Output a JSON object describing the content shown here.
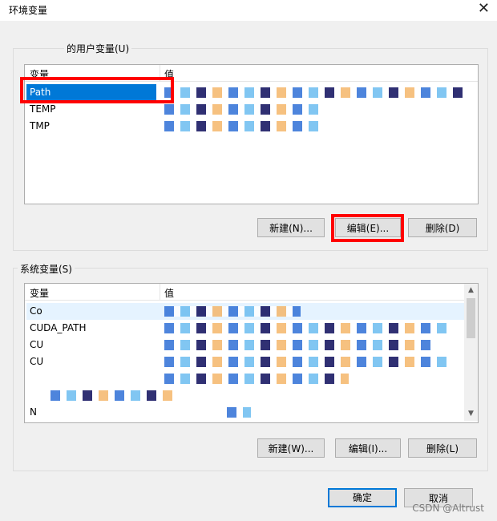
{
  "window": {
    "title": "环境变量",
    "close_glyph": "✕"
  },
  "user_section": {
    "group_label": "的用户变量(U)",
    "columns": {
      "name": "变量",
      "value": "值"
    },
    "rows": [
      {
        "name": "Path",
        "selected": true
      },
      {
        "name": "TEMP",
        "selected": false
      },
      {
        "name": "TMP",
        "selected": false
      }
    ],
    "buttons": {
      "new": "新建(N)...",
      "edit": "编辑(E)...",
      "delete": "删除(D)"
    }
  },
  "system_section": {
    "group_label": "系统变量(S)",
    "columns": {
      "name": "变量",
      "value": "值"
    },
    "rows": [
      {
        "name": "Co",
        "hover": true
      },
      {
        "name": "CUDA_PATH",
        "hover": false
      },
      {
        "name": "CU",
        "hover": false
      },
      {
        "name": "CU",
        "hover": false
      },
      {
        "name": "",
        "hover": false
      },
      {
        "name": "",
        "hover": false
      },
      {
        "name": "N",
        "hover": false
      }
    ],
    "buttons": {
      "new": "新建(W)...",
      "edit": "编辑(I)...",
      "delete": "删除(L)"
    }
  },
  "dialog_buttons": {
    "ok": "确定",
    "cancel": "取消"
  },
  "watermark": "CSDN @Altrust",
  "colors": {
    "selection": "#0078d7",
    "highlight_box": "#ff0000",
    "hover_row": "#e5f3ff"
  }
}
